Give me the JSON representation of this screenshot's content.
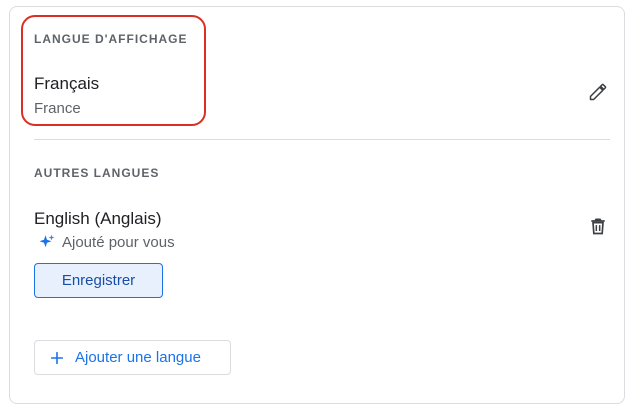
{
  "display_language": {
    "section_title": "LANGUE D'AFFICHAGE",
    "language": "Français",
    "region": "France",
    "edit_icon": "pencil-icon"
  },
  "other_languages": {
    "section_title": "AUTRES LANGUES",
    "items": [
      {
        "language": "English (Anglais)",
        "note": "Ajouté pour vous",
        "note_icon": "sparkle-icon",
        "delete_icon": "trash-icon",
        "save_label": "Enregistrer"
      }
    ],
    "add_label": "Ajouter une langue",
    "add_icon": "plus-icon"
  },
  "colors": {
    "accent": "#1a73e8",
    "highlight": "#d93025",
    "save_bg": "#e8f0fe"
  }
}
